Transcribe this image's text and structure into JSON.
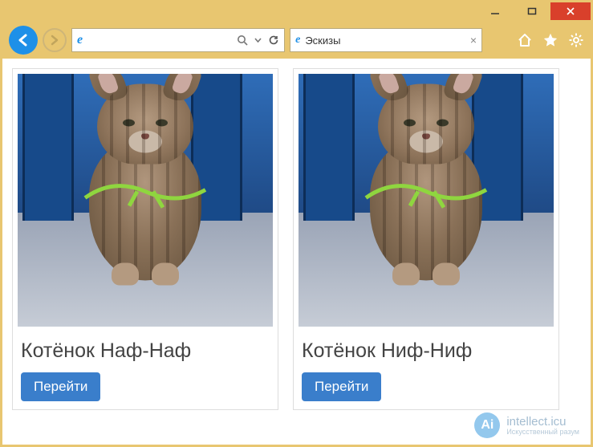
{
  "window": {
    "close_glyph": "✕",
    "minimize_glyph": "—",
    "maximize_glyph": "▢"
  },
  "toolbar": {
    "address_value": "",
    "search_icon": "search-icon",
    "dropdown_icon": "chevron-down-icon",
    "refresh_icon": "refresh-icon"
  },
  "tab": {
    "title": "Эскизы",
    "close_glyph": "×"
  },
  "cards": [
    {
      "caption": "Котёнок Наф-Наф",
      "button": "Перейти"
    },
    {
      "caption": "Котёнок Ниф-Ниф",
      "button": "Перейти"
    }
  ],
  "watermark": {
    "badge": "Ai",
    "text": "intellect.icu",
    "sub": "Искусственный разум"
  }
}
